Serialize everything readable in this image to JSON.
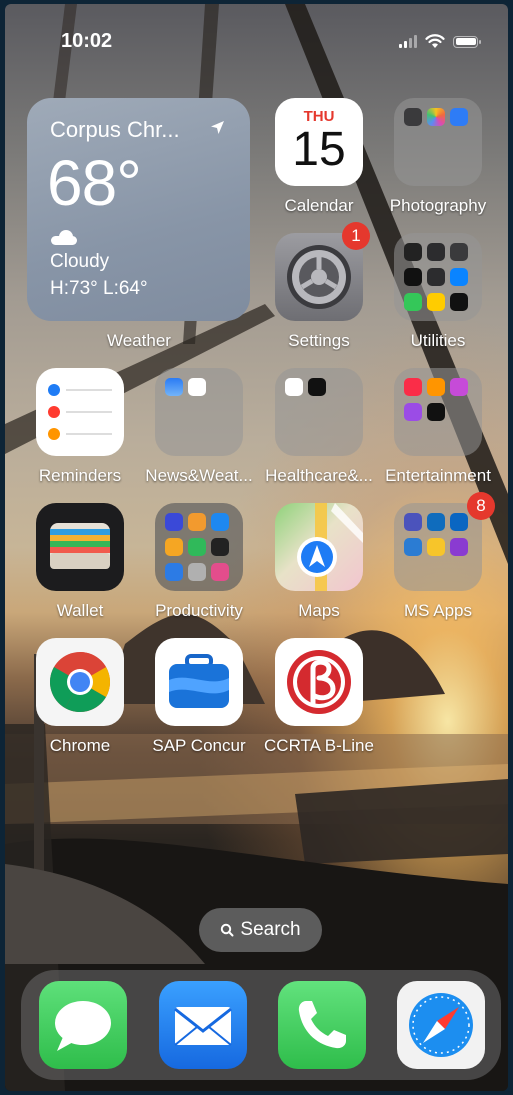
{
  "status_bar": {
    "time": "10:02"
  },
  "weather_widget": {
    "city": "Corpus Chr...",
    "temperature": "68°",
    "condition": "Cloudy",
    "high_low": "H:73° L:64°",
    "label": "Weather"
  },
  "apps": {
    "calendar": {
      "label": "Calendar",
      "day": "THU",
      "date": "15"
    },
    "photography": {
      "label": "Photography"
    },
    "settings": {
      "label": "Settings",
      "badge": "1"
    },
    "utilities": {
      "label": "Utilities"
    },
    "reminders": {
      "label": "Reminders"
    },
    "news_weather": {
      "label": "News&Weat..."
    },
    "healthcare": {
      "label": "Healthcare&..."
    },
    "entertainment": {
      "label": "Entertainment"
    },
    "wallet": {
      "label": "Wallet"
    },
    "productivity": {
      "label": "Productivity"
    },
    "maps": {
      "label": "Maps"
    },
    "ms_apps": {
      "label": "MS Apps",
      "badge": "8"
    },
    "chrome": {
      "label": "Chrome"
    },
    "sap_concur": {
      "label": "SAP Concur"
    },
    "ccrta": {
      "label": "CCRTA B-Line"
    }
  },
  "search": {
    "label": "Search"
  },
  "dock": [
    "Messages",
    "Mail",
    "Phone",
    "Safari"
  ],
  "colors": {
    "badge": "#e5382d",
    "calendar_day": "#e5382d",
    "messages": "#34c759",
    "mail": "#1e88f0",
    "ccrta": "#d42a2f"
  }
}
